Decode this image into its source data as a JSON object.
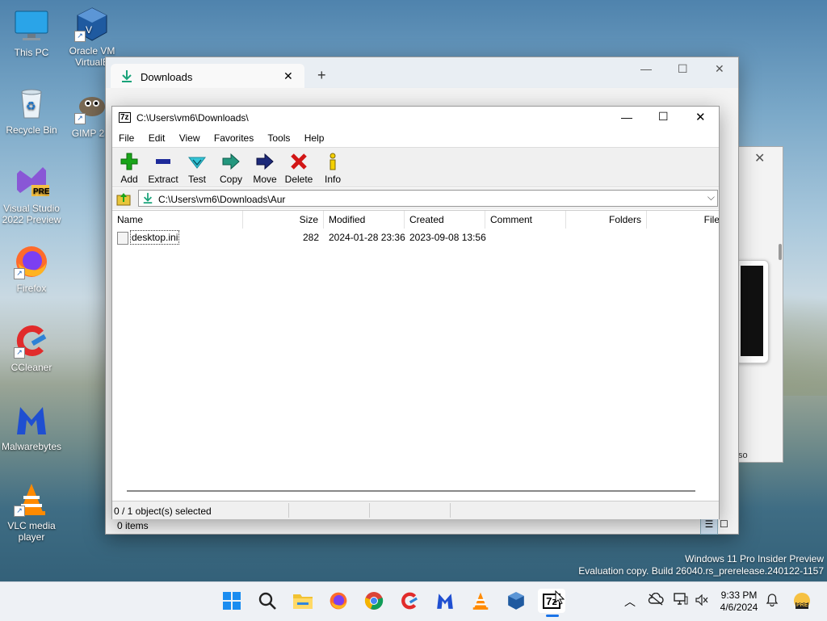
{
  "desktop": {
    "icons": [
      {
        "label": "This PC"
      },
      {
        "label": "Oracle VM VirtualB"
      },
      {
        "label": "Recycle Bin"
      },
      {
        "label": "GIMP 2.1"
      },
      {
        "label": "Visual Studio 2022 Preview"
      },
      {
        "label": "Firefox"
      },
      {
        "label": "CCleaner"
      },
      {
        "label": "Malwarebytes"
      },
      {
        "label": "VLC media player"
      }
    ],
    "watermark_line1": "Windows 11 Pro Insider Preview",
    "watermark_line2": "Evaluation copy. Build 26040.rs_prerelease.240122-1157"
  },
  "explorer": {
    "tab_title": "Downloads",
    "new_tab": "+",
    "status": "0 items",
    "partial_text": "so"
  },
  "sevenzip": {
    "title": "C:\\Users\\vm6\\Downloads\\",
    "title_icon": "7z",
    "menu": [
      "File",
      "Edit",
      "View",
      "Favorites",
      "Tools",
      "Help"
    ],
    "toolbar": [
      {
        "label": "Add",
        "icon": "plus-icon"
      },
      {
        "label": "Extract",
        "icon": "minus-icon"
      },
      {
        "label": "Test",
        "icon": "check-icon"
      },
      {
        "label": "Copy",
        "icon": "copy-arrow-icon"
      },
      {
        "label": "Move",
        "icon": "move-arrow-icon"
      },
      {
        "label": "Delete",
        "icon": "delete-x-icon"
      },
      {
        "label": "Info",
        "icon": "info-icon"
      }
    ],
    "address": "C:\\Users\\vm6\\Downloads\\Aur",
    "columns": [
      "Name",
      "Size",
      "Modified",
      "Created",
      "Comment",
      "Folders",
      "File"
    ],
    "rows": [
      {
        "name": "desktop.ini",
        "size": "282",
        "modified": "2024-01-28 23:36",
        "created": "2023-09-08 13:56"
      }
    ],
    "status": "0 / 1 object(s) selected"
  },
  "taskbar": {
    "time": "9:33 PM",
    "date": "4/6/2024",
    "pre_badge": "PRE",
    "apps": [
      "windows-start-icon",
      "search-icon",
      "file-explorer-icon",
      "firefox-icon",
      "chrome-icon",
      "ccleaner-icon",
      "malwarebytes-icon",
      "vlc-icon",
      "virtualbox-icon",
      "sevenzip-icon"
    ]
  },
  "colors": {
    "accent": "#1a73e8",
    "add_green": "#1aa51a",
    "extract_blue": "#1d2a9a",
    "delete_red": "#d21616"
  }
}
